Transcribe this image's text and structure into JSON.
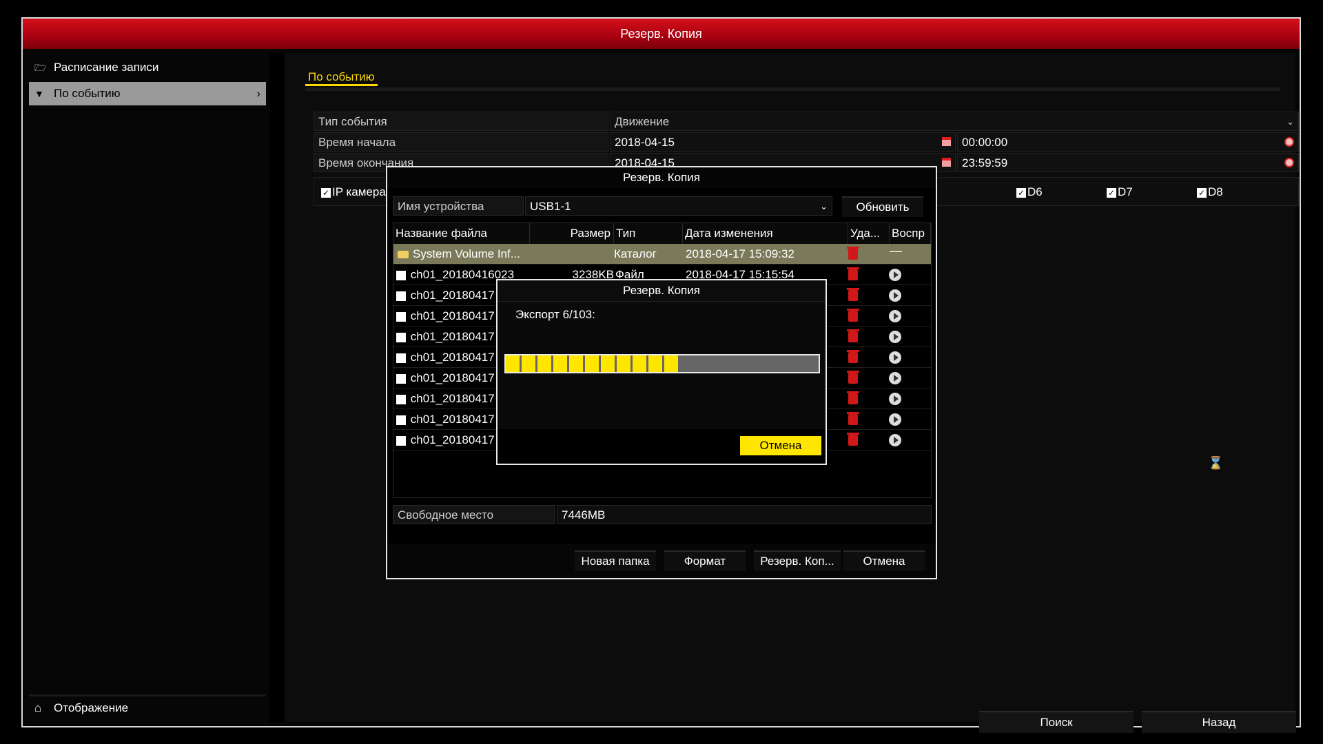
{
  "window": {
    "title": "Резерв. Копия"
  },
  "sidebar": {
    "items": [
      {
        "label": "Расписание записи",
        "icon": "folder-icon"
      },
      {
        "label": "По событию",
        "icon": "pin-icon",
        "active": true
      }
    ],
    "bottom": {
      "label": "Отображение",
      "icon": "home-icon"
    }
  },
  "main": {
    "tab": "По событию",
    "event_type": {
      "label": "Тип события",
      "value": "Движение"
    },
    "start_time": {
      "label": "Время начала",
      "date": "2018-04-15",
      "time": "00:00:00"
    },
    "end_time": {
      "label": "Время окончания",
      "date": "2018-04-15",
      "time": "23:59:59"
    },
    "cameras": {
      "group_label": "IP камера",
      "items": [
        {
          "label": "D6",
          "checked": true
        },
        {
          "label": "D7",
          "checked": true
        },
        {
          "label": "D8",
          "checked": true
        }
      ]
    },
    "search_button": "Поиск",
    "back_button": "Назад"
  },
  "backup_dialog": {
    "title": "Резерв. Копия",
    "device_label": "Имя устройства",
    "device_value": "USB1-1",
    "refresh_button": "Обновить",
    "columns": [
      "Название файла",
      "Размер",
      "Тип",
      "Дата изменения",
      "Уда...",
      "Воспр"
    ],
    "rows": [
      {
        "name": "System Volume Inf...",
        "size": "",
        "type": "Каталог",
        "date": "2018-04-17 15:09:32",
        "is_folder": true
      },
      {
        "name": "ch01_20180416023",
        "size": "3238KB",
        "type": "Файл",
        "date": "2018-04-17 15:15:54"
      },
      {
        "name": "ch01_20180417",
        "size": "",
        "type": "",
        "date": ""
      },
      {
        "name": "ch01_20180417",
        "size": "",
        "type": "",
        "date": ""
      },
      {
        "name": "ch01_20180417",
        "size": "",
        "type": "",
        "date": ""
      },
      {
        "name": "ch01_20180417",
        "size": "",
        "type": "",
        "date": ""
      },
      {
        "name": "ch01_20180417",
        "size": "",
        "type": "",
        "date": ""
      },
      {
        "name": "ch01_20180417",
        "size": "",
        "type": "",
        "date": ""
      },
      {
        "name": "ch01_20180417",
        "size": "",
        "type": "",
        "date": ""
      },
      {
        "name": "ch01_20180417",
        "size": "",
        "type": "",
        "date": ""
      }
    ],
    "free_space_label": "Свободное место",
    "free_space_value": "7446MB",
    "buttons": {
      "new_folder": "Новая папка",
      "format": "Формат",
      "backup": "Резерв. Коп...",
      "cancel": "Отмена"
    }
  },
  "progress_dialog": {
    "title": "Резерв. Копия",
    "message": "Экспорт 6/103:",
    "progress_percent": 55,
    "cancel_button": "Отмена"
  },
  "colors": {
    "accent": "#ffe600",
    "title_red": "#c00010",
    "delete_red": "#d01818"
  }
}
